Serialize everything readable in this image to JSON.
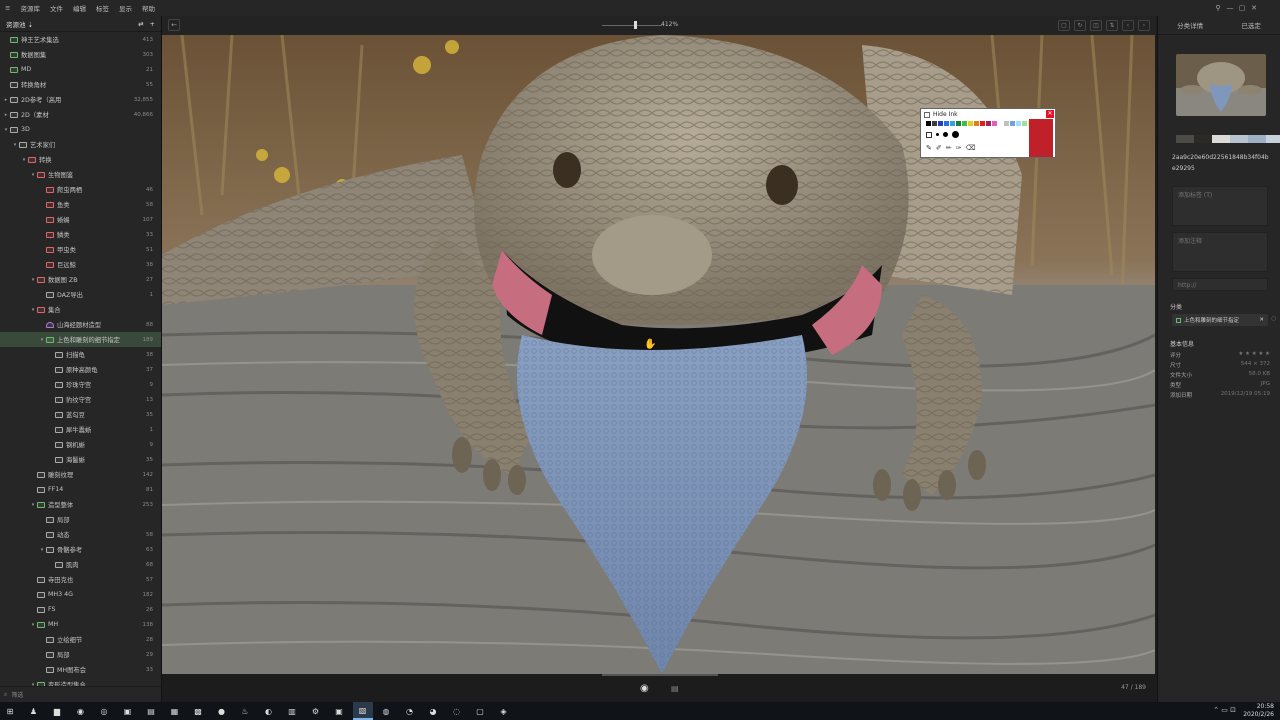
{
  "menubar": {
    "items": [
      "资源库",
      "文件",
      "编辑",
      "标签",
      "显示",
      "帮助"
    ],
    "window_controls": [
      "⚲",
      "—",
      "▢",
      "✕"
    ]
  },
  "sidebar": {
    "header": "资源池 ⇣",
    "footer": "筛选",
    "rows": [
      {
        "label": "神王艺术集选",
        "count": "413",
        "indent": 0,
        "color": "g",
        "tw": ""
      },
      {
        "label": "数据图集",
        "count": "303",
        "indent": 0,
        "color": "g",
        "tw": ""
      },
      {
        "label": "MD",
        "count": "21",
        "indent": 0,
        "color": "g",
        "tw": ""
      },
      {
        "label": "转换角材",
        "count": "55",
        "indent": 0,
        "color": "w",
        "tw": ""
      },
      {
        "label": "2D参考（高用",
        "count": "32,855",
        "indent": 0,
        "color": "w",
        "tw": "▸"
      },
      {
        "label": "2D（素材",
        "count": "40,866",
        "indent": 0,
        "color": "w",
        "tw": "▸"
      },
      {
        "label": "3D",
        "count": "",
        "indent": 0,
        "color": "w",
        "tw": "▾"
      },
      {
        "label": "艺术家们",
        "count": "",
        "indent": 1,
        "color": "w",
        "tw": "▾"
      },
      {
        "label": "转换",
        "count": "",
        "indent": 2,
        "color": "r",
        "tw": "▾"
      },
      {
        "label": "生物图鉴",
        "count": "",
        "indent": 3,
        "color": "r",
        "tw": "▾"
      },
      {
        "label": "爬虫两栖",
        "count": "46",
        "indent": 4,
        "color": "r",
        "tw": ""
      },
      {
        "label": "鱼类",
        "count": "58",
        "indent": 4,
        "color": "r",
        "tw": ""
      },
      {
        "label": "蜥蜴",
        "count": "107",
        "indent": 4,
        "color": "r",
        "tw": ""
      },
      {
        "label": "鳞类",
        "count": "33",
        "indent": 4,
        "color": "r",
        "tw": ""
      },
      {
        "label": "甲虫类",
        "count": "51",
        "indent": 4,
        "color": "r",
        "tw": ""
      },
      {
        "label": "巨远鲸",
        "count": "38",
        "indent": 4,
        "color": "r",
        "tw": ""
      },
      {
        "label": "数据图 ZB",
        "count": "27",
        "indent": 3,
        "color": "r",
        "tw": "▾"
      },
      {
        "label": "DAZ导出",
        "count": "1",
        "indent": 4,
        "color": "w",
        "tw": ""
      },
      {
        "label": "集合",
        "count": "",
        "indent": 3,
        "color": "r",
        "tw": "▾"
      },
      {
        "label": "山海经题材造型",
        "count": "88",
        "indent": 4,
        "color": "p",
        "tw": ""
      },
      {
        "label": "上色和雕刻的细节指定",
        "count": "189",
        "indent": 4,
        "color": "g",
        "tw": "▾",
        "selected": true
      },
      {
        "label": "扫描龟",
        "count": "38",
        "indent": 5,
        "color": "w",
        "tw": ""
      },
      {
        "label": "原种高颜龟",
        "count": "37",
        "indent": 5,
        "color": "w",
        "tw": ""
      },
      {
        "label": "珍珠守宫",
        "count": "9",
        "indent": 5,
        "color": "w",
        "tw": ""
      },
      {
        "label": "豹纹守宫",
        "count": "13",
        "indent": 5,
        "color": "w",
        "tw": ""
      },
      {
        "label": "蓝勾豆",
        "count": "35",
        "indent": 5,
        "color": "w",
        "tw": ""
      },
      {
        "label": "犀牛蠹蜥",
        "count": "1",
        "indent": 5,
        "color": "w",
        "tw": ""
      },
      {
        "label": "钢机蜥",
        "count": "9",
        "indent": 5,
        "color": "w",
        "tw": ""
      },
      {
        "label": "海鬣蜥",
        "count": "35",
        "indent": 5,
        "color": "w",
        "tw": ""
      },
      {
        "label": "雕刻纹理",
        "count": "142",
        "indent": 3,
        "color": "w",
        "tw": ""
      },
      {
        "label": "FF14",
        "count": "81",
        "indent": 3,
        "color": "w",
        "tw": ""
      },
      {
        "label": "造型整体",
        "count": "253",
        "indent": 3,
        "color": "g",
        "tw": "▾"
      },
      {
        "label": "局部",
        "count": "",
        "indent": 4,
        "color": "w",
        "tw": ""
      },
      {
        "label": "动态",
        "count": "58",
        "indent": 4,
        "color": "w",
        "tw": ""
      },
      {
        "label": "骨骼参考",
        "count": "63",
        "indent": 4,
        "color": "w",
        "tw": "▾"
      },
      {
        "label": "肌肉",
        "count": "68",
        "indent": 5,
        "color": "w",
        "tw": ""
      },
      {
        "label": "寺田克也",
        "count": "57",
        "indent": 3,
        "color": "w",
        "tw": ""
      },
      {
        "label": "MH3 4G",
        "count": "182",
        "indent": 3,
        "color": "w",
        "tw": ""
      },
      {
        "label": "FS",
        "count": "26",
        "indent": 3,
        "color": "w",
        "tw": ""
      },
      {
        "label": "MH",
        "count": "138",
        "indent": 3,
        "color": "g",
        "tw": "▾"
      },
      {
        "label": "立绘细节",
        "count": "28",
        "indent": 4,
        "color": "w",
        "tw": ""
      },
      {
        "label": "局部",
        "count": "29",
        "indent": 4,
        "color": "w",
        "tw": ""
      },
      {
        "label": "MH图布会",
        "count": "33",
        "indent": 4,
        "color": "w",
        "tw": ""
      },
      {
        "label": "变形造型集合",
        "count": "",
        "indent": 3,
        "color": "g",
        "tw": "▾"
      }
    ]
  },
  "viewer": {
    "zoom": "412%",
    "page_counter": "47 / 189",
    "zoom_fraction": 0.53
  },
  "ink_panel": {
    "title": "Hide Ink",
    "close": "✕",
    "swatches": [
      "#000000",
      "#3a3a3a",
      "#1f3fbf",
      "#2a6fe0",
      "#2fa4e0",
      "#1c7c3a",
      "#3fbf3f",
      "#e0d020",
      "#e08020",
      "#e02020",
      "#a02060",
      "#e060c0",
      "#ffffff",
      "#c0c0c0",
      "#6fa0e0",
      "#9fe0ff",
      "#9fe09f",
      "#f0f080",
      "#f0c090"
    ],
    "current_color": "#c0202a"
  },
  "right_panel": {
    "tabs": [
      "分类详情",
      "已选定"
    ],
    "palette": [
      "#4d4b45",
      "#2b2a27",
      "#dcdad5",
      "#b9c3cf",
      "#9fb0c6",
      "#c8d0da"
    ],
    "hash": "2aa9c20e60d22561848b34f04be29295",
    "tags_placeholder": "添加标签 (T)",
    "notes_placeholder": "添加注释",
    "url_placeholder": "http://",
    "folder_section": "分类",
    "folder_tag": "上色和雕刻的细节指定",
    "info_section": "基本信息",
    "info": [
      {
        "k": "评分",
        "v": "★ ★ ★ ★ ★"
      },
      {
        "k": "尺寸",
        "v": "544 × 372"
      },
      {
        "k": "文件大小",
        "v": "58.0 KB"
      },
      {
        "k": "类型",
        "v": "JPG"
      },
      {
        "k": "添加日期",
        "v": "2019/12/19 05:19"
      }
    ]
  },
  "taskbar": {
    "time": "20:58",
    "date": "2020/2/26",
    "icons": [
      "⊞",
      "♟",
      "▆",
      "◉",
      "◎",
      "▣",
      "▤",
      "▦",
      "▩",
      "●",
      "♨",
      "◐",
      "▥",
      "⚙",
      "▣",
      "▧",
      "◍",
      "◔",
      "◕",
      "◌",
      "▢",
      "◈"
    ]
  }
}
